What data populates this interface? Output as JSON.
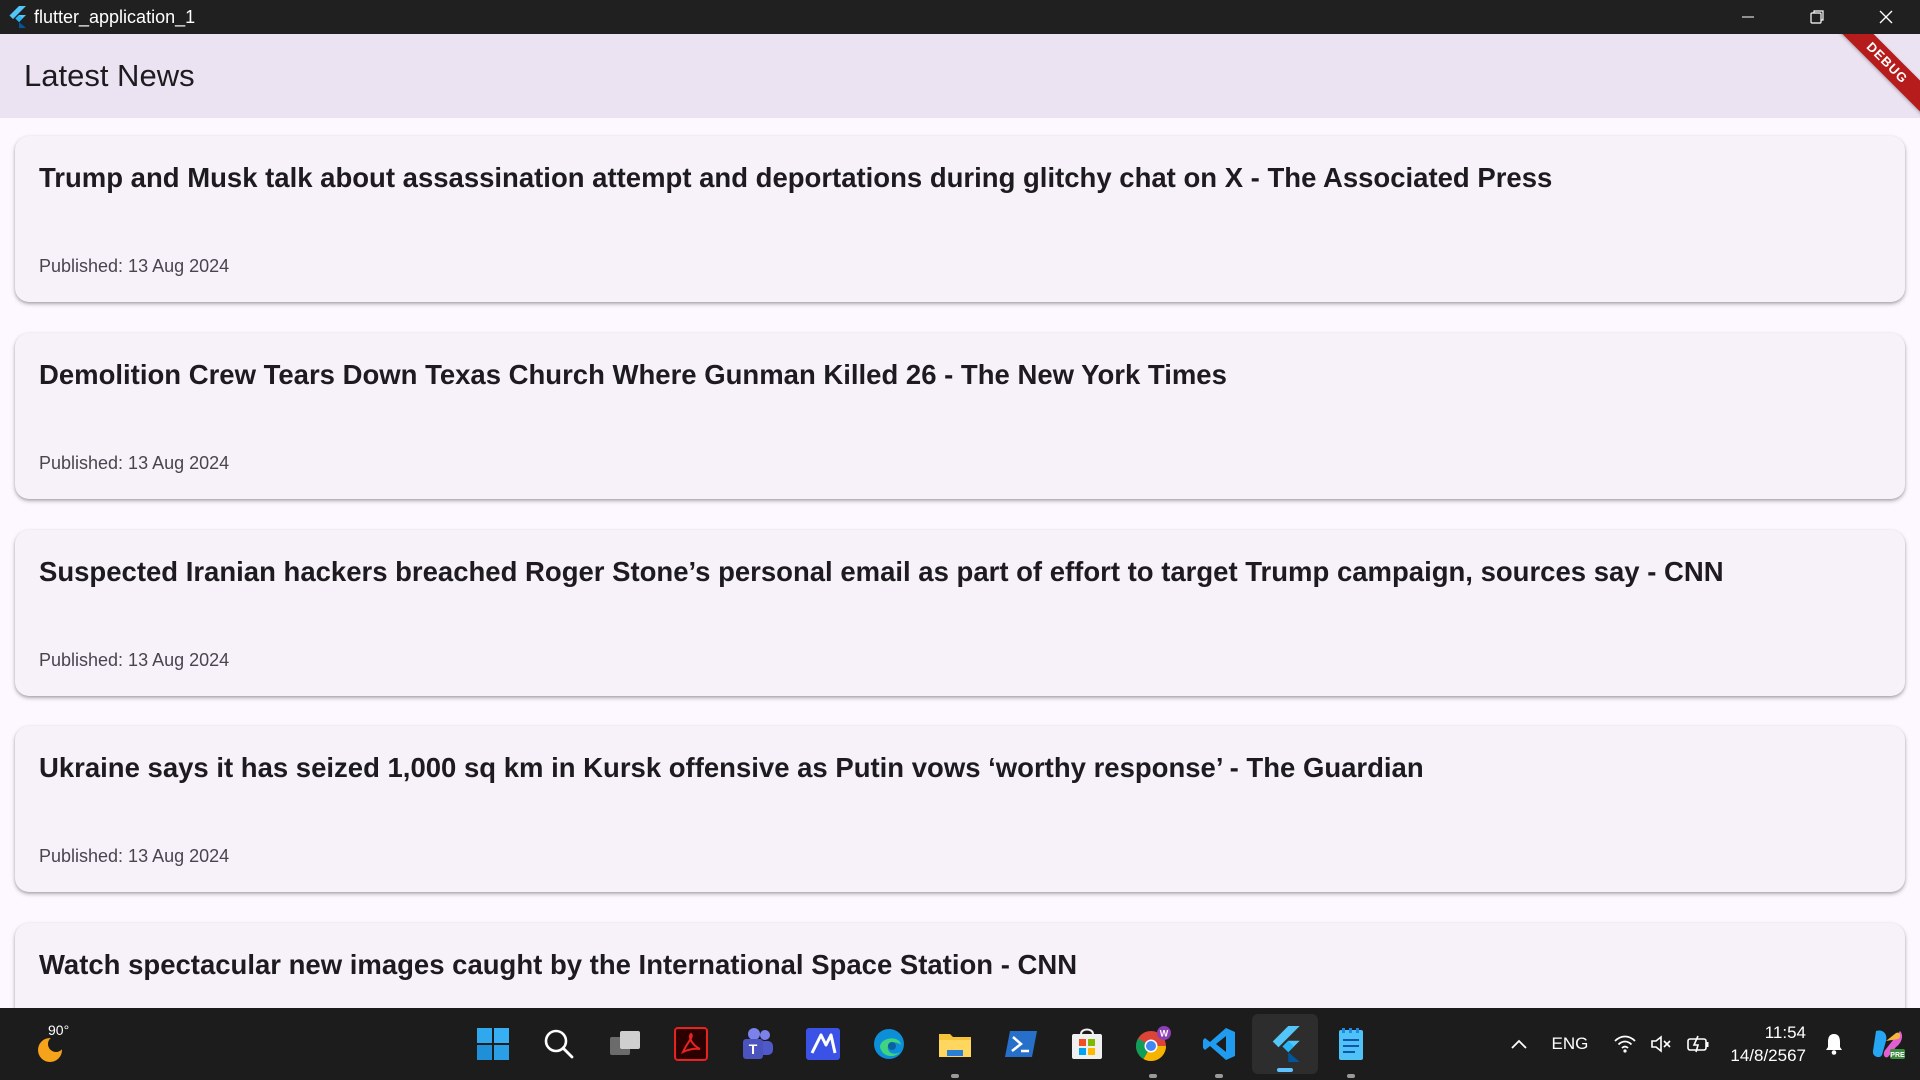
{
  "window": {
    "title": "flutter_application_1"
  },
  "appbar": {
    "title": "Latest News",
    "debug_banner": "DEBUG"
  },
  "articles": [
    {
      "headline": "Trump and Musk talk about assassination attempt and deportations during glitchy chat on X - The Associated Press",
      "published": "Published: 13 Aug 2024"
    },
    {
      "headline": "Demolition Crew Tears Down Texas Church Where Gunman Killed 26 - The New York Times",
      "published": "Published: 13 Aug 2024"
    },
    {
      "headline": "Suspected Iranian hackers breached Roger Stone’s personal email as part of effort to target Trump campaign, sources say - CNN",
      "published": "Published: 13 Aug 2024"
    },
    {
      "headline": "Ukraine says it has seized 1,000 sq km in Kursk offensive as Putin vows ‘worthy response’ - The Guardian",
      "published": "Published: 13 Aug 2024"
    },
    {
      "headline": "Watch spectacular new images caught by the International Space Station - CNN",
      "published": ""
    }
  ],
  "taskbar": {
    "weather_temp": "90°",
    "language": "ENG",
    "time": "11:54",
    "date": "14/8/2567",
    "apps": [
      "windows-start",
      "search",
      "task-view",
      "acrobat-reader",
      "teams",
      "visual-studio",
      "edge",
      "file-explorer",
      "powershell",
      "microsoft-store",
      "chrome",
      "vscode",
      "flutter-app",
      "notepad"
    ]
  },
  "colors": {
    "appbar": "#ece3f2",
    "background": "#fdf7ff",
    "card": "#f7f2fa",
    "titlebar": "#202020",
    "taskbar": "#1c1c1c",
    "debug": "#b71c1c"
  }
}
